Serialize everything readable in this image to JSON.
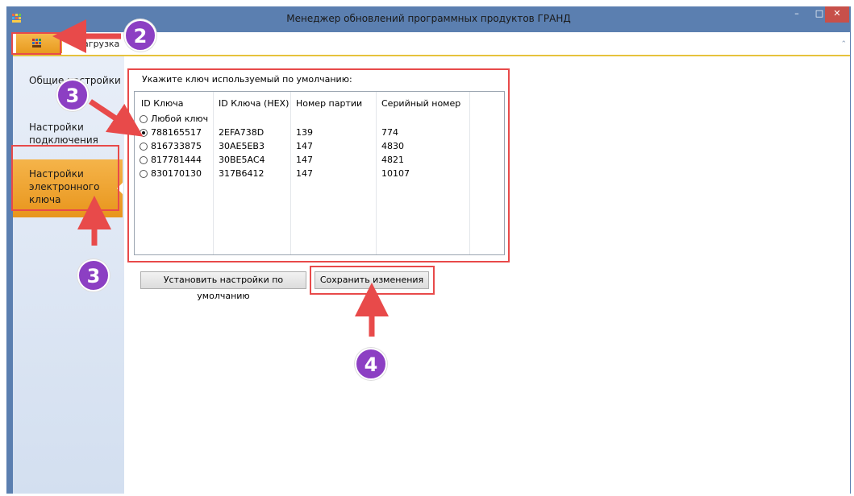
{
  "window": {
    "title": "Менеджер обновлений программных продуктов ГРАНД"
  },
  "ribbon": {
    "tab_load": "Загрузка"
  },
  "sidebar": {
    "items": [
      {
        "label": "Общие настройки"
      },
      {
        "label": "Настройки подключения"
      },
      {
        "label": "Настройки электронного ключа",
        "selected": true
      }
    ]
  },
  "keys": {
    "group_label": "Укажите ключ используемый по умолчанию:",
    "columns": [
      "ID Ключа",
      "ID Ключа (HEX)",
      "Номер партии",
      "Серийный номер"
    ],
    "any_key_label": "Любой ключ",
    "rows": [
      {
        "id": "788165517",
        "hex": "2EFA738D",
        "batch": "139",
        "serial": "774",
        "selected": true
      },
      {
        "id": "816733875",
        "hex": "30AE5EB3",
        "batch": "147",
        "serial": "4830",
        "selected": false
      },
      {
        "id": "817781444",
        "hex": "30BE5AC4",
        "batch": "147",
        "serial": "4821",
        "selected": false
      },
      {
        "id": "830170130",
        "hex": "317B6412",
        "batch": "147",
        "serial": "10107",
        "selected": false
      }
    ]
  },
  "buttons": {
    "defaults": "Установить настройки по умолчанию",
    "save": "Сохранить изменения"
  },
  "annotations": {
    "badge_2": "2",
    "badge_3a": "3",
    "badge_3b": "3",
    "badge_4": "4"
  },
  "colors": {
    "accent": "#e8951c",
    "highlight": "#e84a4a",
    "badge": "#8c3fc3"
  }
}
